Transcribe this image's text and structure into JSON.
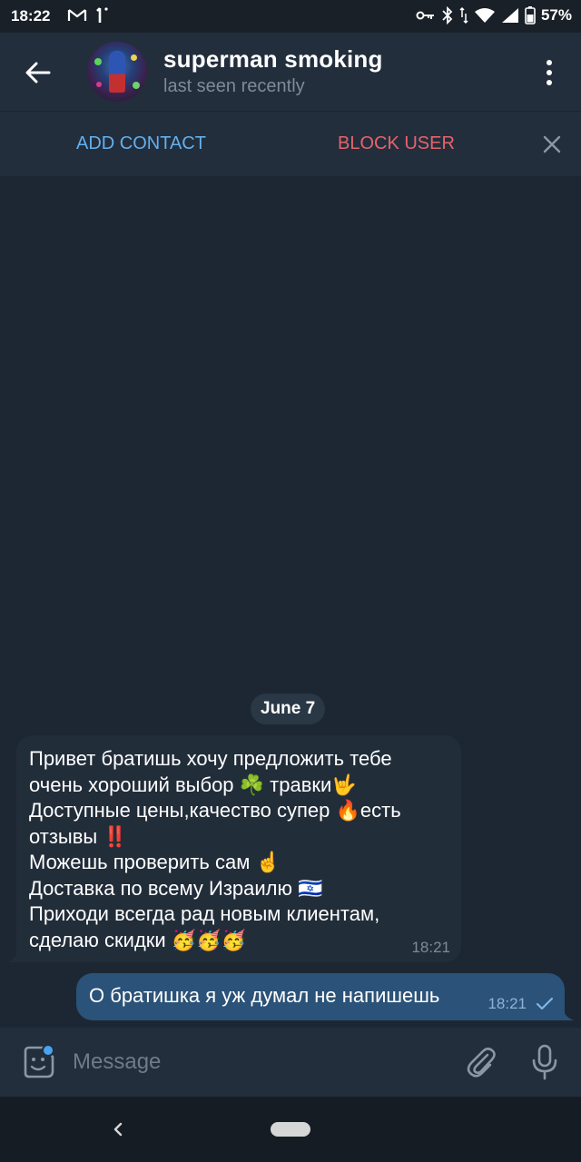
{
  "status_bar": {
    "time": "18:22",
    "battery_percent": "57%",
    "icons": [
      "gmail-icon",
      "notification-icon",
      "vpn-key-icon",
      "bluetooth-icon",
      "data-arrows-icon",
      "wifi-icon",
      "signal-icon",
      "battery-icon"
    ]
  },
  "header": {
    "contact_name": "superman smoking",
    "contact_status": "last seen recently"
  },
  "action_bar": {
    "add_contact": "ADD CONTACT",
    "block_user": "BLOCK USER"
  },
  "chat": {
    "date_separator": "June 7",
    "incoming": {
      "lines": [
        "Привет братишь хочу предложить тебе",
        "очень хороший выбор ☘️ травки🤟",
        "Доступные цены,качество супер 🔥есть",
        "отзывы ‼️",
        "Можешь проверить сам ☝️",
        "Доставка по всему Израилю 🇮🇱",
        "Приходи всегда рад новым клиентам,",
        "сделаю скидки 🥳🥳🥳"
      ],
      "time": "18:21"
    },
    "outgoing": {
      "text": "О братишка я уж думал не напишешь",
      "time": "18:21",
      "status": "sent"
    }
  },
  "composer": {
    "placeholder": "Message"
  },
  "colors": {
    "background": "#1d2733",
    "header": "#232e3c",
    "accent_blue": "#62b0ee",
    "danger_red": "#e6636c",
    "incoming_bubble": "#222d3a",
    "outgoing_bubble": "#2b5278"
  }
}
